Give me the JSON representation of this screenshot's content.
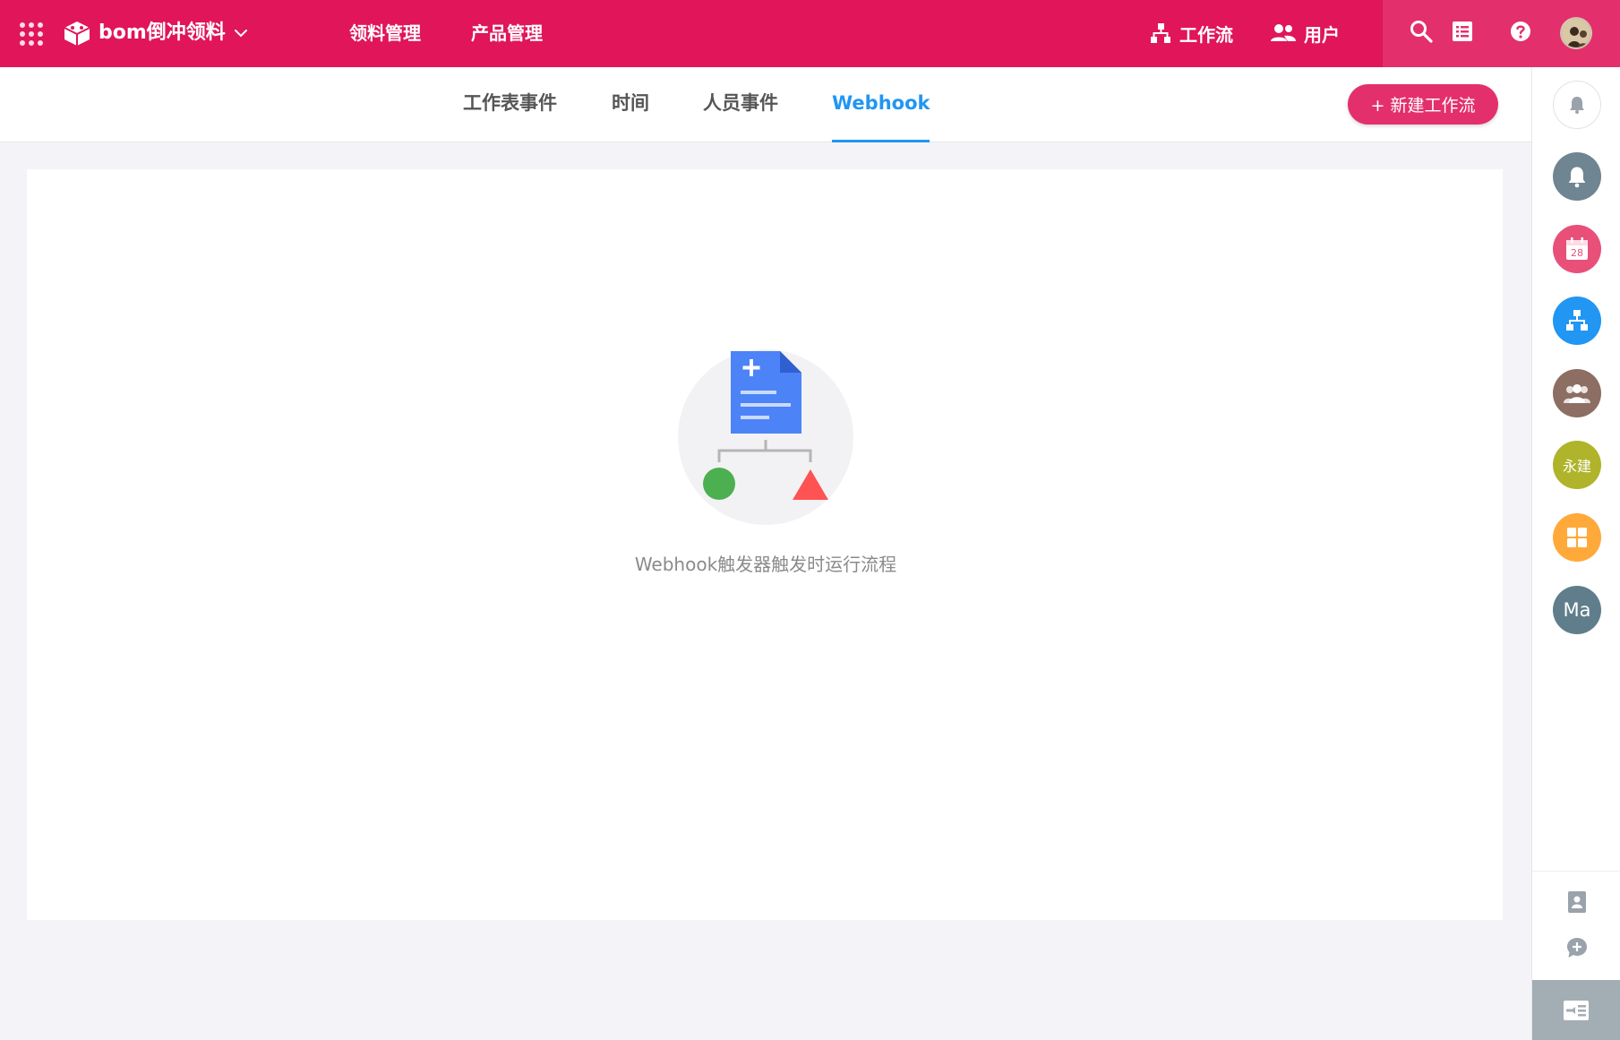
{
  "header": {
    "app_name": "bom倒冲领料",
    "nav": [
      "领料管理",
      "产品管理"
    ],
    "workflow_label": "工作流",
    "users_label": "用户"
  },
  "tabs": [
    {
      "label": "工作表事件",
      "active": false
    },
    {
      "label": "时间",
      "active": false
    },
    {
      "label": "人员事件",
      "active": false
    },
    {
      "label": "Webhook",
      "active": true
    }
  ],
  "new_workflow_label": "+ 新建工作流",
  "empty_state": {
    "message": "Webhook触发器触发时运行流程"
  },
  "sidebar": {
    "calendar_day": "28",
    "org_label": "永建",
    "user_initials": "Ma"
  },
  "colors": {
    "brand": "#e0155a",
    "accent_blue": "#2196f3"
  }
}
